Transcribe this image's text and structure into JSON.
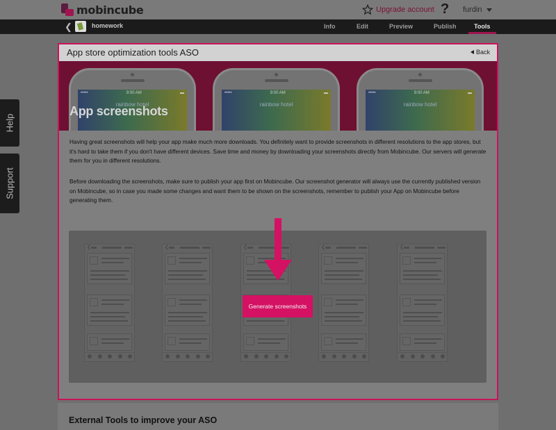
{
  "header": {
    "brand": "mobincube",
    "upgrade_label": "Upgrade account",
    "help_icon": "question-mark-icon",
    "user_name": "furdin"
  },
  "nav": {
    "app_name": "homework",
    "tabs": [
      {
        "label": "Info",
        "active": false
      },
      {
        "label": "Edit",
        "active": false
      },
      {
        "label": "Preview",
        "active": false
      },
      {
        "label": "Publish",
        "active": false
      },
      {
        "label": "Tools",
        "active": true
      }
    ]
  },
  "side_tabs": {
    "help": "Help",
    "support": "Support"
  },
  "panel": {
    "title": "App store optimization tools ASO",
    "back_label": "Back",
    "hero_title": "App screenshots",
    "phones": [
      {
        "time": "9:00 AM",
        "app": "rainbow hotel"
      },
      {
        "time": "9:00 AM",
        "app": "rainbow hotel"
      },
      {
        "time": "9:00 AM",
        "app": "rainbow hotel"
      }
    ],
    "paragraph_1": "Having great screenshots will help your app make much more downloads. You definitely want to provide screenshots in different resolutions to the app stores, but it's hard to take them if you don't have different devices. Save time and money by downloading your screenshots directly from Mobincube. Our servers will generate them for you in different resolutions.",
    "paragraph_2": "Before downloading the screenshots, make sure to publish your app first on Mobincube. Our screenshot generator will always use the currently published version on Mobincube, so in case you made some changes and want them to be shown on the screenshots, remember to publish your App on Mobincube before generating them.",
    "generate_button": "Generate screenshots"
  },
  "external_tools_title": "External Tools to improve your ASO",
  "colors": {
    "accent": "#d41163",
    "hero_bg": "#6e1032",
    "navbar": "#1b1b1b"
  }
}
